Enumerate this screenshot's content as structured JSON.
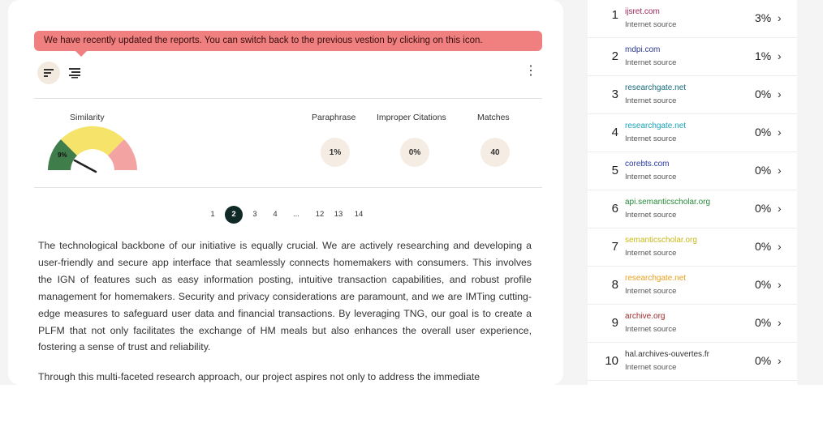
{
  "banner": {
    "text": "We have recently updated the reports. You can switch back to the previous vestion by clicking on this icon."
  },
  "view_toggle": {
    "left_icon": "sort-lines-icon",
    "right_icon": "list-lines-icon",
    "more_icon": "kebab-menu-icon"
  },
  "similarity": {
    "label": "Similarity",
    "value": "9%",
    "gauge_level": 0.09,
    "colors": [
      "#3f7d4a",
      "#f6e36a",
      "#f4a3a3"
    ]
  },
  "metrics": [
    {
      "label": "Paraphrase",
      "value": "1%"
    },
    {
      "label": "Improper Citations",
      "value": "0%"
    },
    {
      "label": "Matches",
      "value": "40"
    }
  ],
  "pagination": {
    "pages": [
      "1",
      "2",
      "3",
      "4",
      "...",
      "12",
      "13",
      "14"
    ],
    "current": "2"
  },
  "document": {
    "paragraphs": [
      "The technological backbone of our initiative is equally crucial. We are actively researching and developing a user-friendly and secure app interface that seamlessly connects homemakers with consumers. This involves the IGN of features such as easy information posting, intuitive transaction capabilities, and robust profile management for homemakers. Security and privacy considerations are paramount, and we are IMTing cutting-edge measures to safeguard user data and financial transactions. By leveraging TNG, our goal is to create a PLFM that not only facilitates the exchange of HM meals but also enhances the overall user experience, fostering a sense of trust and reliability.",
      "Through this multi-faceted research approach, our project aspires not only to address the immediate"
    ]
  },
  "sources": [
    {
      "rank": "1",
      "domain": "ijsret.com",
      "type": "Internet source",
      "percent": "3%",
      "color": "#a0265a"
    },
    {
      "rank": "2",
      "domain": "mdpi.com",
      "type": "Internet source",
      "percent": "1%",
      "color": "#2c3a8c"
    },
    {
      "rank": "3",
      "domain": "researchgate.net",
      "type": "Internet source",
      "percent": "0%",
      "color": "#1a6a7a"
    },
    {
      "rank": "4",
      "domain": "researchgate.net",
      "type": "Internet source",
      "percent": "0%",
      "color": "#1aa3b8"
    },
    {
      "rank": "5",
      "domain": "corebts.com",
      "type": "Internet source",
      "percent": "0%",
      "color": "#2a3aa0"
    },
    {
      "rank": "6",
      "domain": "api.semanticscholar.org",
      "type": "Internet source",
      "percent": "0%",
      "color": "#2a8a3a"
    },
    {
      "rank": "7",
      "domain": "semanticscholar.org",
      "type": "Internet source",
      "percent": "0%",
      "color": "#c8b81a"
    },
    {
      "rank": "8",
      "domain": "researchgate.net",
      "type": "Internet source",
      "percent": "0%",
      "color": "#e8a020"
    },
    {
      "rank": "9",
      "domain": "archive.org",
      "type": "Internet source",
      "percent": "0%",
      "color": "#a02a2a"
    },
    {
      "rank": "10",
      "domain": "hal.archives-ouvertes.fr",
      "type": "Internet source",
      "percent": "0%",
      "color": "#333333"
    }
  ]
}
